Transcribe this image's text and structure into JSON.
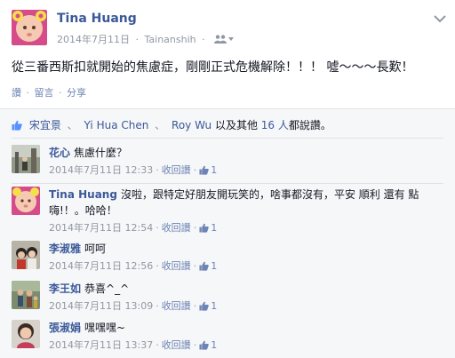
{
  "post": {
    "author": "Tina Huang",
    "date": "2014年7月11日",
    "dot": "·",
    "location": "Tainanshih",
    "text": "從三番西斯扣就開始的焦慮症，剛剛正式危機解除！！！ 噓～～～長歎！",
    "actions": {
      "like": "讚",
      "comment": "留言",
      "share": "分享",
      "sep": "·"
    }
  },
  "likes": {
    "names": [
      "宋宜景",
      "Yi Hua Chen",
      "Roy Wu"
    ],
    "sep": "、",
    "suffix_pre": "以及其他",
    "others_count": "16 人",
    "suffix_post": "都說讚。"
  },
  "comments": [
    {
      "name": "花心",
      "text": "焦慮什麼？",
      "date": "2014年7月11日 12:33",
      "unlike": "收回讚",
      "like_count": "1"
    },
    {
      "name": "Tina Huang",
      "text": "沒啦，跟特定好朋友開玩笑的，啥事都沒有，平安 順利 還有 點嗨!！。哈哈！",
      "date": "2014年7月11日 12:54",
      "unlike": "收回讚",
      "like_count": "1"
    },
    {
      "name": "李淑雅",
      "text": "呵呵",
      "date": "2014年7月11日 12:56",
      "unlike": "收回讚",
      "like_count": "1"
    },
    {
      "name": "李王如",
      "text": "恭喜^_^",
      "date": "2014年7月11日 13:09",
      "unlike": "收回讚",
      "like_count": "1"
    },
    {
      "name": "張淑娟",
      "text": "嘿嘿嘿~",
      "date": "2014年7月11日 13:37",
      "unlike": "收回讚",
      "like_count": "1"
    }
  ],
  "meta_sep": "·",
  "colors": {
    "link": "#3b5998",
    "muted": "#9197a3",
    "action": "#6d84b4",
    "ufi_bg": "#f6f7f9"
  },
  "icons": [
    "chevron-down-icon",
    "audience-friends-icon",
    "thumbs-up-icon"
  ]
}
